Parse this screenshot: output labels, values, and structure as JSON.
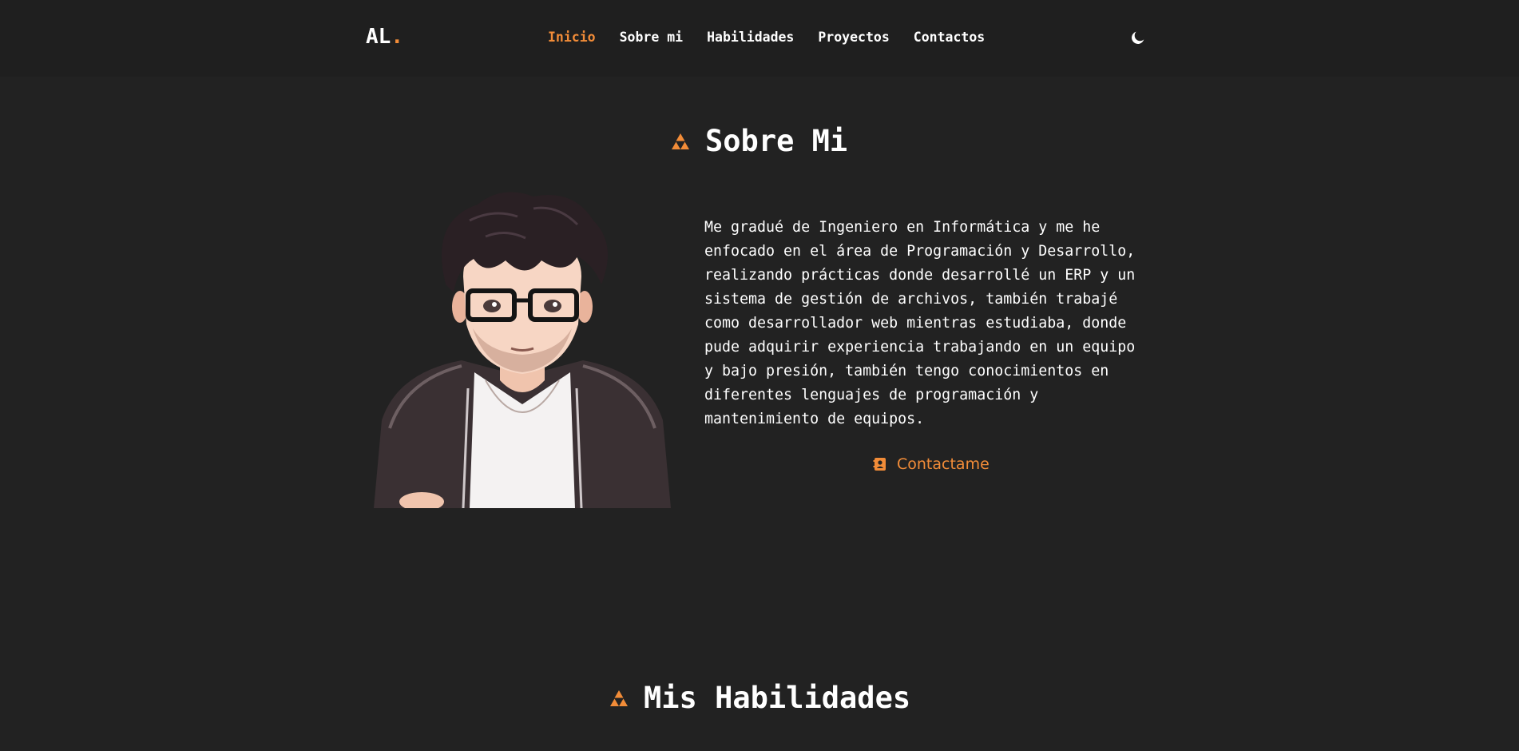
{
  "header": {
    "logo_text": "AL",
    "logo_dot": ".",
    "nav": [
      {
        "label": "Inicio",
        "active": true
      },
      {
        "label": "Sobre mi",
        "active": false
      },
      {
        "label": "Habilidades",
        "active": false
      },
      {
        "label": "Proyectos",
        "active": false
      },
      {
        "label": "Contactos",
        "active": false
      }
    ],
    "theme_icon": "moon-icon"
  },
  "about": {
    "title": "Sobre Mi",
    "title_icon": "triforce-icon",
    "avatar_icon": "avatar-illustration",
    "bio": "Me gradué de Ingeniero en Informática y me he enfocado en el área de Programación y Desarrollo, realizando prácticas donde desarrollé un ERP y un sistema de gestión de archivos, también trabajé como desarrollador web mientras estudiaba, donde pude adquirir experiencia trabajando en un equipo y bajo presión, también tengo conocimientos en diferentes lenguajes de programación y mantenimiento de equipos.",
    "contact_label": "Contactame",
    "contact_icon": "contact-card-icon"
  },
  "skills": {
    "title": "Mis Habilidades",
    "title_icon": "triforce-icon"
  },
  "colors": {
    "accent": "#f28c38",
    "background": "#222222",
    "header_bg": "#1f1f1f",
    "text": "#ffffff"
  }
}
